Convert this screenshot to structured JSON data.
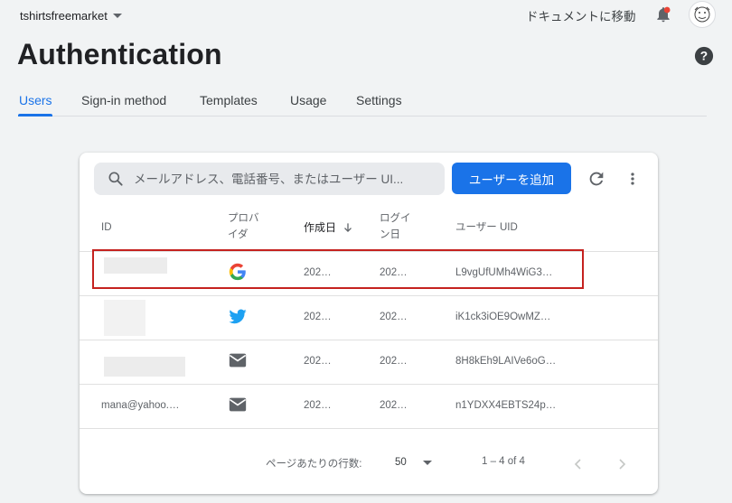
{
  "topbar": {
    "project_name": "tshirtsfreemarket",
    "docs_link": "ドキュメントに移動"
  },
  "page": {
    "title": "Authentication"
  },
  "tabs": [
    {
      "label": "Users",
      "active": true
    },
    {
      "label": "Sign-in method",
      "active": false
    },
    {
      "label": "Templates",
      "active": false
    },
    {
      "label": "Usage",
      "active": false
    },
    {
      "label": "Settings",
      "active": false
    }
  ],
  "toolbar": {
    "search_placeholder": "メールアドレス、電話番号、またはユーザー UI...",
    "add_user_label": "ユーザーを追加"
  },
  "table": {
    "headers": {
      "id": "ID",
      "provider_line1": "プロバ",
      "provider_line2": "イダ",
      "created": "作成日",
      "login_line1": "ログイ",
      "login_line2": "ン日",
      "uid": "ユーザー UID"
    },
    "rows": [
      {
        "id": "",
        "provider": "google-icon",
        "created": "202…",
        "signed_in": "202…",
        "uid": "L9vgUfUMh4WiG3…"
      },
      {
        "id": "",
        "provider": "twitter-icon",
        "created": "202…",
        "signed_in": "202…",
        "uid": "iK1ck3iOE9OwMZ…"
      },
      {
        "id": "",
        "provider": "email-icon",
        "created": "202…",
        "signed_in": "202…",
        "uid": "8H8kEh9LAIVe6oG…"
      },
      {
        "id": "mana@yahoo.…",
        "provider": "email-icon",
        "created": "202…",
        "signed_in": "202…",
        "uid": "n1YDXX4EBTS24p…"
      }
    ]
  },
  "pagination": {
    "rows_per_page_label": "ページあたりの行数:",
    "rows_per_page_value": "50",
    "range": "1 – 4 of 4"
  },
  "colors": {
    "accent": "#1a73e8",
    "highlight": "#c5221f",
    "notification": "#ea4335"
  }
}
